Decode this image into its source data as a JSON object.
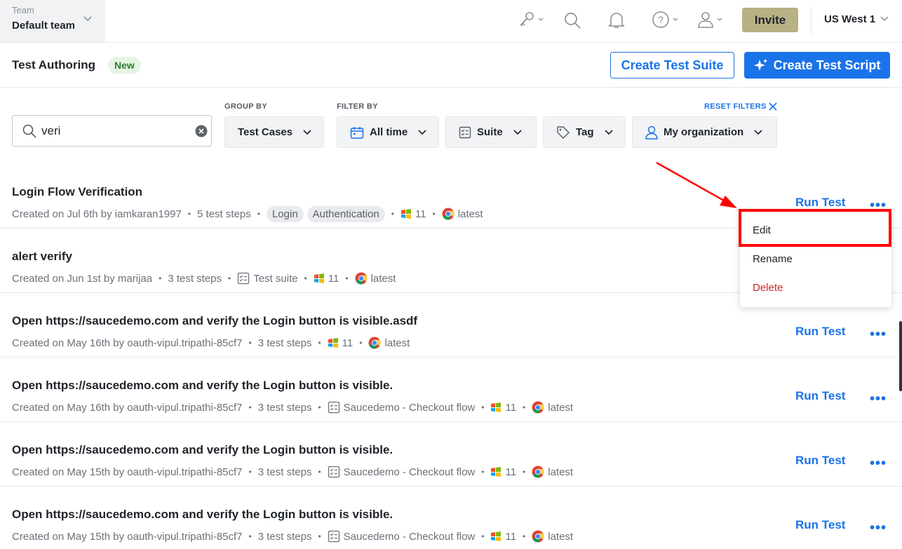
{
  "topbar": {
    "team_label": "Team",
    "team_value": "Default team",
    "invite_label": "Invite",
    "region_label": "US West 1",
    "icons": [
      "key-icon",
      "search-icon",
      "bell-icon",
      "help-icon",
      "user-icon"
    ]
  },
  "header": {
    "title": "Test Authoring",
    "badge": "New",
    "create_suite_label": "Create Test Suite",
    "create_script_label": "Create Test Script"
  },
  "filters": {
    "search_value": "veri",
    "group_by_label": "GROUP BY",
    "filter_by_label": "FILTER BY",
    "reset_label": "RESET FILTERS",
    "group_by_value": "Test Cases",
    "time_value": "All time",
    "suite_value": "Suite",
    "tag_value": "Tag",
    "org_value": "My organization"
  },
  "rows": [
    {
      "name": "Login Flow Verification",
      "created": "Created on Jul 6th by iamkaran1997",
      "steps": "5 test steps",
      "tags": [
        "Login",
        "Authentication"
      ],
      "suite": "",
      "os_version": "11",
      "browser_version": "latest",
      "run_label": "Run Test",
      "more_label": "•••"
    },
    {
      "name": "alert verify",
      "created": "Created on Jun 1st by marijaa",
      "steps": "3 test steps",
      "tags": [],
      "suite": "Test suite",
      "os_version": "11",
      "browser_version": "latest",
      "run_label": "",
      "more_label": ""
    },
    {
      "name": "Open https://saucedemo.com and verify the Login button is visible.asdf",
      "created": "Created on May 16th by oauth-vipul.tripathi-85cf7",
      "steps": "3 test steps",
      "tags": [],
      "suite": "",
      "os_version": "11",
      "browser_version": "latest",
      "run_label": "Run Test",
      "more_label": "•••"
    },
    {
      "name": "Open https://saucedemo.com and verify the Login button is visible.",
      "created": "Created on May 16th by oauth-vipul.tripathi-85cf7",
      "steps": "3 test steps",
      "tags": [],
      "suite": "Saucedemo - Checkout flow",
      "os_version": "11",
      "browser_version": "latest",
      "run_label": "Run Test",
      "more_label": "•••"
    },
    {
      "name": "Open https://saucedemo.com and verify the Login button is visible.",
      "created": "Created on May 15th by oauth-vipul.tripathi-85cf7",
      "steps": "3 test steps",
      "tags": [],
      "suite": "Saucedemo - Checkout flow",
      "os_version": "11",
      "browser_version": "latest",
      "run_label": "Run Test",
      "more_label": "•••"
    },
    {
      "name": "Open https://saucedemo.com and verify the Login button is visible.",
      "created": "Created on May 15th by oauth-vipul.tripathi-85cf7",
      "steps": "3 test steps",
      "tags": [],
      "suite": "Saucedemo - Checkout flow",
      "os_version": "11",
      "browser_version": "latest",
      "run_label": "Run Test",
      "more_label": "•••"
    }
  ],
  "context_menu": {
    "items": [
      "Edit",
      "Rename",
      "Delete"
    ],
    "highlighted": "Edit"
  },
  "colors": {
    "accent": "#1a73e8",
    "invite": "#b7b184",
    "delete": "#c62828",
    "annotation": "#ff0000"
  }
}
